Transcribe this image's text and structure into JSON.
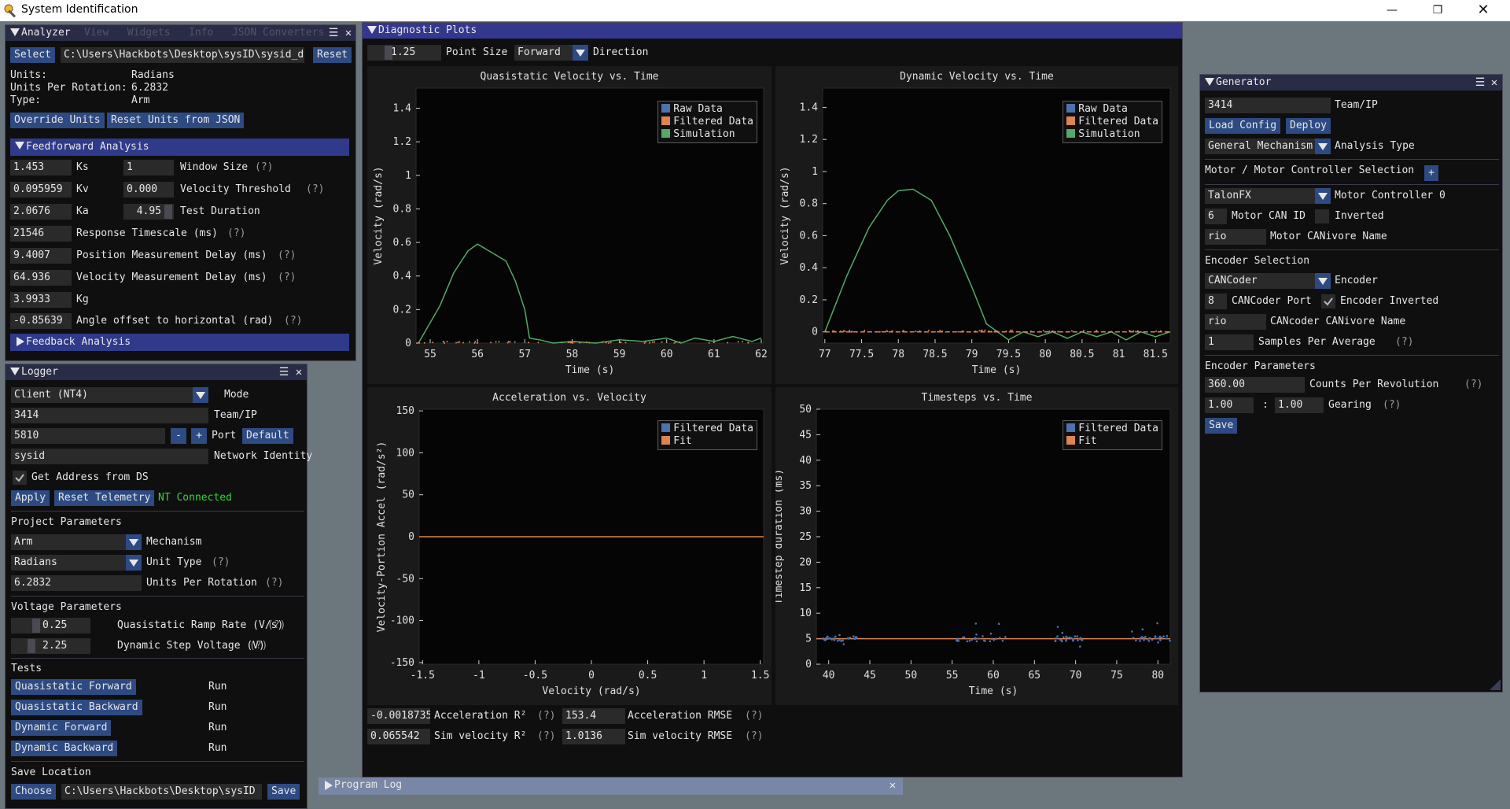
{
  "window": {
    "title": "System Identification"
  },
  "menubar": {
    "items": [
      "View",
      "Widgets",
      "Info",
      "JSON Converters"
    ]
  },
  "analyzer": {
    "title": "Analyzer",
    "select_label": "Select",
    "path": "C:\\Users\\Hackbots\\Desktop\\sysID\\sysid_da",
    "reset_label": "Reset",
    "units_label": "Units:",
    "units_value": "Radians",
    "upr_label": "Units Per Rotation:",
    "upr_value": "6.2832",
    "type_label": "Type:",
    "type_value": "Arm",
    "override_label": "Override Units",
    "reset_json_label": "Reset Units from JSON",
    "ff_header": "Feedforward Analysis",
    "ks_value": "1.453",
    "ks_label": "Ks",
    "window_size_value": "1",
    "window_size_label": "Window Size",
    "kv_value": "0.095959",
    "kv_label": "Kv",
    "vel_thresh_value": "0.000",
    "vel_thresh_label": "Velocity Threshold",
    "ka_value": "2.0676",
    "ka_label": "Ka",
    "test_dur_value": "4.95",
    "test_dur_label": "Test Duration",
    "resp_value": "21546",
    "resp_label": "Response Timescale (ms)",
    "pos_delay_value": "9.4007",
    "pos_delay_label": "Position Measurement Delay (ms)",
    "vel_delay_value": "64.936",
    "vel_delay_label": "Velocity Measurement Delay (ms)",
    "kg_value": "3.9933",
    "kg_label": "Kg",
    "angle_value": "-0.85639",
    "angle_label": "Angle offset to horizontal (rad)",
    "fb_header": "Feedback Analysis",
    "help": "(?)"
  },
  "logger": {
    "title": "Logger",
    "mode_value": "Client (NT4)",
    "mode_label": "Mode",
    "team_value": "3414",
    "team_label": "Team/IP",
    "port_value": "5810",
    "minus": "-",
    "plus": "+",
    "port_label": "Port",
    "default_label": "Default",
    "netid_value": "sysid",
    "netid_label": "Network Identity",
    "ds_label": "Get Address from DS",
    "apply_label": "Apply",
    "reset_tel_label": "Reset Telemetry",
    "status": "NT Connected",
    "proj_header": "Project Parameters",
    "mech_value": "Arm",
    "mech_label": "Mechanism",
    "unit_value": "Radians",
    "unit_label": "Unit Type",
    "upr_value": "6.2832",
    "upr_label": "Units Per Rotation",
    "volt_header": "Voltage Parameters",
    "ramp_value": "0.25",
    "ramp_label": "Quasistatic Ramp Rate (V/s)",
    "step_value": "2.25",
    "step_label": "Dynamic Step Voltage (V)",
    "tests_header": "Tests",
    "tests": [
      {
        "label": "Quasistatic Forward",
        "status": "Run"
      },
      {
        "label": "Quasistatic Backward",
        "status": "Run"
      },
      {
        "label": "Dynamic Forward",
        "status": "Run"
      },
      {
        "label": "Dynamic Backward",
        "status": "Run"
      }
    ],
    "save_header": "Save Location",
    "choose_label": "Choose",
    "save_path": "C:\\Users\\Hackbots\\Desktop\\sysID",
    "save_label": "Save",
    "help": "(?)"
  },
  "diagnostic": {
    "title": "Diagnostic Plots",
    "point_size_value": "1.25",
    "point_size_label": "Point Size",
    "direction_value": "Forward",
    "direction_label": "Direction",
    "accel_r2_value": "-0.0018735",
    "accel_r2_label": "Acceleration R²",
    "accel_rmse_value": "153.4",
    "accel_rmse_label": "Acceleration RMSE",
    "sim_r2_value": "0.065542",
    "sim_r2_label": "Sim velocity R²",
    "sim_rmse_value": "1.0136",
    "sim_rmse_label": "Sim velocity RMSE",
    "help": "(?)"
  },
  "generator": {
    "title": "Generator",
    "team_value": "3414",
    "team_label": "Team/IP",
    "load_label": "Load Config",
    "deploy_label": "Deploy",
    "analysis_value": "General Mechanism",
    "analysis_label": "Analysis Type",
    "motor_header": "Motor / Motor Controller Selection",
    "add": "+",
    "controller_value": "TalonFX",
    "controller_label": "Motor Controller 0",
    "can_value": "6",
    "can_label": "Motor CAN ID",
    "inverted_label": "Inverted",
    "canivore_value": "rio",
    "canivore_label": "Motor CANivore Name",
    "enc_header": "Encoder Selection",
    "encoder_value": "CANCoder",
    "encoder_label": "Encoder",
    "port_value": "8",
    "port_label": "CANCoder Port",
    "enc_inverted_label": "Encoder Inverted",
    "enc_canivore_value": "rio",
    "enc_canivore_label": "CANcoder CANivore Name",
    "samples_value": "1",
    "samples_label": "Samples Per Average",
    "params_header": "Encoder Parameters",
    "cpr_value": "360.00",
    "cpr_label": "Counts Per Revolution",
    "gear1": "1.00",
    "colon": ":",
    "gear2": "1.00",
    "gearing_label": "Gearing",
    "save_label": "Save",
    "help": "(?)"
  },
  "program_log": {
    "title": "Program Log"
  },
  "colors": {
    "raw": "#4c72b0",
    "filtered": "#dd8452",
    "simulation": "#55a868",
    "accent": "#33388e"
  },
  "chart_data": [
    {
      "type": "line",
      "title": "Quasistatic Velocity vs. Time",
      "xlabel": "Time (s)",
      "ylabel": "Velocity (rad/s)",
      "xlim": [
        54.7,
        62.05
      ],
      "ylim": [
        0,
        1.52
      ],
      "xticks": [
        55,
        56,
        57,
        58,
        59,
        60,
        61,
        62
      ],
      "yticks": [
        0,
        0.2,
        0.4,
        0.6,
        0.8,
        1,
        1.2,
        1.4
      ],
      "legend": [
        "Raw Data",
        "Filtered Data",
        "Simulation"
      ],
      "series": [
        {
          "name": "Simulation",
          "x": [
            54.75,
            55.2,
            55.5,
            55.8,
            56,
            56.3,
            56.6,
            56.8,
            57.0,
            57.1,
            57.3,
            57.6,
            58,
            58.5,
            59,
            59.5,
            60,
            60.3,
            60.6,
            61,
            61.4,
            61.8,
            62
          ],
          "y": [
            0,
            0.22,
            0.42,
            0.55,
            0.59,
            0.54,
            0.49,
            0.37,
            0.2,
            0.03,
            0.02,
            0,
            0.01,
            0,
            0.02,
            0.01,
            0.03,
            0.0,
            0.03,
            0.01,
            0.04,
            0.01,
            0.03
          ]
        }
      ]
    },
    {
      "type": "line",
      "title": "Dynamic Velocity vs. Time",
      "xlabel": "Time (s)",
      "ylabel": "Velocity (rad/s)",
      "xlim": [
        76.97,
        81.7
      ],
      "ylim": [
        -0.07,
        1.52
      ],
      "xticks": [
        77,
        77.5,
        78,
        78.5,
        79,
        79.5,
        80,
        80.5,
        81,
        81.5
      ],
      "yticks": [
        0,
        0.2,
        0.4,
        0.6,
        0.8,
        1,
        1.2,
        1.4
      ],
      "legend": [
        "Raw Data",
        "Filtered Data",
        "Simulation"
      ],
      "series": [
        {
          "name": "Simulation",
          "x": [
            77,
            77.3,
            77.6,
            77.85,
            78,
            78.2,
            78.45,
            78.7,
            79,
            79.2,
            79.35,
            79.5,
            79.7,
            79.9,
            80.1,
            80.3,
            80.5,
            80.7,
            80.9,
            81.1,
            81.3,
            81.5,
            81.7
          ],
          "y": [
            0,
            0.35,
            0.65,
            0.82,
            0.88,
            0.89,
            0.82,
            0.6,
            0.28,
            0.05,
            0,
            -0.05,
            0,
            -0.03,
            0,
            -0.04,
            0,
            -0.03,
            0,
            -0.05,
            0,
            -0.03,
            0
          ]
        },
        {
          "name": "Filtered Data",
          "x": [
            77,
            81.7
          ],
          "y": [
            0,
            0
          ]
        }
      ]
    },
    {
      "type": "line",
      "title": "Acceleration vs. Velocity",
      "xlabel": "Velocity (rad/s)",
      "ylabel": "Velocity-Portion Accel (rad/s²)",
      "xlim": [
        -1.53,
        1.53
      ],
      "ylim": [
        -152,
        152
      ],
      "xticks": [
        -1.5,
        -1,
        -0.5,
        0,
        0.5,
        1,
        1.5
      ],
      "yticks": [
        -150,
        -100,
        -50,
        0,
        50,
        100,
        150
      ],
      "legend": [
        "Filtered Data",
        "Fit"
      ],
      "series": [
        {
          "name": "Fit",
          "x": [
            -1.53,
            1.53
          ],
          "y": [
            0,
            0
          ]
        }
      ]
    },
    {
      "type": "scatter",
      "title": "Timesteps vs. Time",
      "xlabel": "Time (s)",
      "ylabel": "Timestep duration (ms)",
      "xlim": [
        38.5,
        81.5
      ],
      "ylim": [
        0,
        50
      ],
      "xticks": [
        40,
        45,
        50,
        55,
        60,
        65,
        70,
        75,
        80
      ],
      "yticks": [
        0,
        5,
        10,
        15,
        20,
        25,
        30,
        35,
        40,
        45,
        50
      ],
      "legend": [
        "Filtered Data",
        "Fit"
      ],
      "series": [
        {
          "name": "Fit",
          "x": [
            38.5,
            81.5
          ],
          "y": [
            5,
            5
          ]
        }
      ]
    }
  ]
}
